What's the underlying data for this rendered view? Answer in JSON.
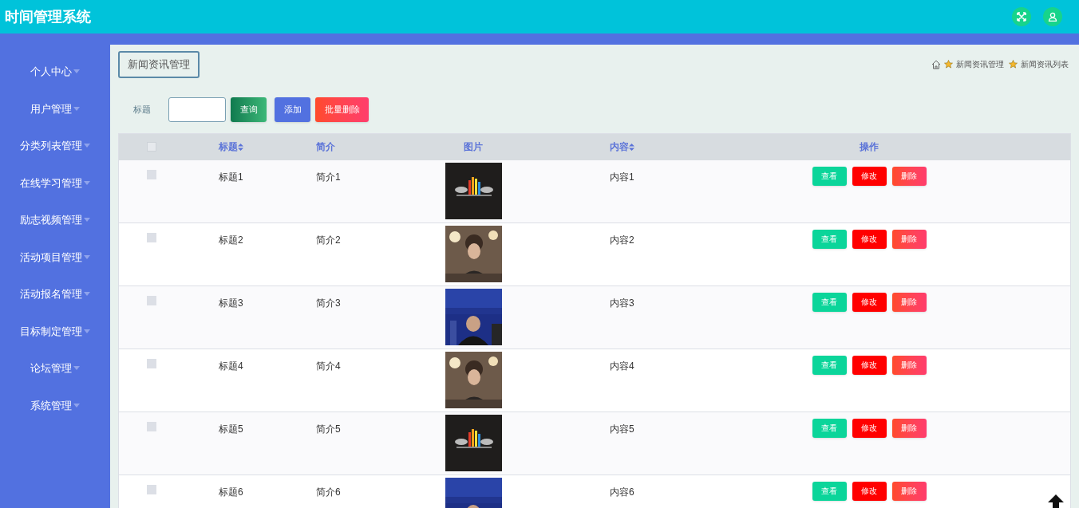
{
  "header": {
    "title": "时间管理系统"
  },
  "sidebar": {
    "items": [
      {
        "label": "个人中心",
        "expanded": false
      },
      {
        "label": "用户管理",
        "expanded": false
      },
      {
        "label": "分类列表管理",
        "expanded": false
      },
      {
        "label": "在线学习管理",
        "expanded": false
      },
      {
        "label": "励志视频管理",
        "expanded": false
      },
      {
        "label": "活动项目管理",
        "expanded": false
      },
      {
        "label": "活动报名管理",
        "expanded": false
      },
      {
        "label": "目标制定管理",
        "expanded": false
      },
      {
        "label": "论坛管理",
        "expanded": false
      },
      {
        "label": "系统管理",
        "expanded": false
      }
    ]
  },
  "page_title": "新闻资讯管理",
  "breadcrumb": [
    "新闻资讯管理",
    "新闻资讯列表"
  ],
  "search": {
    "label": "标题",
    "buttons": [
      {
        "label": "查询",
        "kind": "query"
      },
      {
        "label": "添加",
        "kind": "add"
      },
      {
        "label": "批量删除",
        "kind": "batch-delete"
      }
    ]
  },
  "table": {
    "select_all": {
      "checked": false
    },
    "columns": [
      {
        "label": "标题",
        "sortable": true
      },
      {
        "label": "简介",
        "sortable": false
      },
      {
        "label": "图片",
        "sortable": false
      },
      {
        "label": "内容",
        "sortable": true
      },
      {
        "label": "操作",
        "sortable": false
      }
    ],
    "rows": [
      {
        "checked": false,
        "title": "标题1",
        "summary": "简介1",
        "content": "内容1",
        "actions": [
          "查看",
          "修改",
          "删除"
        ]
      },
      {
        "checked": false,
        "title": "标题2",
        "summary": "简介2",
        "content": "内容2",
        "actions": [
          "查看",
          "修改",
          "删除"
        ]
      },
      {
        "checked": false,
        "title": "标题3",
        "summary": "简介3",
        "content": "内容3",
        "actions": [
          "查看",
          "修改",
          "删除"
        ]
      },
      {
        "checked": false,
        "title": "标题4",
        "summary": "简介4",
        "content": "内容4",
        "actions": [
          "查看",
          "修改",
          "删除"
        ]
      },
      {
        "checked": false,
        "title": "标题5",
        "summary": "简介5",
        "content": "内容5",
        "actions": [
          "查看",
          "修改",
          "删除"
        ]
      },
      {
        "checked": false,
        "title": "标题6",
        "summary": "简介6",
        "content": "内容6",
        "actions": [
          "查看",
          "修改",
          "删除"
        ]
      }
    ]
  }
}
